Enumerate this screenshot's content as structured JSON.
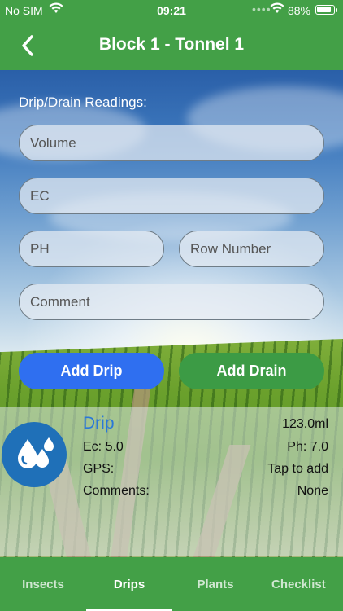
{
  "status_bar": {
    "carrier": "No SIM",
    "time": "09:21",
    "battery": "88%"
  },
  "nav": {
    "title": "Block 1 - Tonnel 1"
  },
  "form": {
    "section_label": "Drip/Drain Readings:",
    "volume_placeholder": "Volume",
    "ec_placeholder": "EC",
    "ph_placeholder": "PH",
    "row_number_placeholder": "Row Number",
    "comment_placeholder": "Comment",
    "add_drip_label": "Add Drip",
    "add_drain_label": "Add Drain"
  },
  "reading": {
    "type": "Drip",
    "volume": "123.0ml",
    "ec": "Ec: 5.0",
    "ph": "Ph: 7.0",
    "gps_label": "GPS:",
    "gps_value": "Tap to add",
    "comments_label": "Comments:",
    "comments_value": "None",
    "icon": "water-drops-icon"
  },
  "tabs": [
    {
      "label": "Insects"
    },
    {
      "label": "Drips",
      "active": true
    },
    {
      "label": "Plants"
    },
    {
      "label": "Checklist"
    }
  ],
  "colors": {
    "primary_green": "#43a047",
    "drip_button": "#2f6ff0",
    "drain_button": "#3c9b45",
    "drip_icon_bg": "#1f70b8",
    "drip_title": "#2a78d8"
  }
}
